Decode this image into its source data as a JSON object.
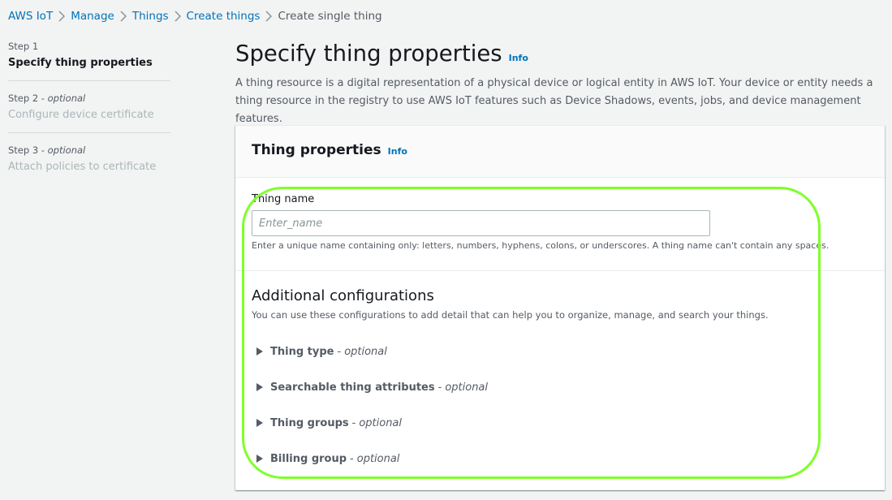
{
  "breadcrumb": {
    "items": [
      "AWS IoT",
      "Manage",
      "Things",
      "Create things"
    ],
    "current": "Create single thing"
  },
  "steps": [
    {
      "num": "Step 1",
      "optional": "",
      "title": "Specify thing properties"
    },
    {
      "num": "Step 2",
      "optional": "optional",
      "title": "Configure device certificate"
    },
    {
      "num": "Step 3",
      "optional": "optional",
      "title": "Attach policies to certificate"
    }
  ],
  "page": {
    "title": "Specify thing properties",
    "info": "Info",
    "description": "A thing resource is a digital representation of a physical device or logical entity in AWS IoT. Your device or entity needs a thing resource in the registry to use AWS IoT features such as Device Shadows, events, jobs, and device management features."
  },
  "panel": {
    "title": "Thing properties",
    "info": "Info",
    "thing_name": {
      "label": "Thing name",
      "placeholder": "Enter_name",
      "value": "",
      "hint": "Enter a unique name containing only: letters, numbers, hyphens, colons, or underscores. A thing name can't contain any spaces."
    },
    "additional": {
      "title": "Additional configurations",
      "description": "You can use these configurations to add detail that can help you to organize, manage, and search your things.",
      "expanders": [
        {
          "label": "Thing type",
          "sep": "-",
          "optional": "optional"
        },
        {
          "label": "Searchable thing attributes",
          "sep": "-",
          "optional": "optional"
        },
        {
          "label": "Thing groups",
          "sep": "-",
          "optional": "optional"
        },
        {
          "label": "Billing group",
          "sep": "-",
          "optional": "optional"
        }
      ]
    }
  },
  "colors": {
    "link": "#0073bb",
    "highlight": "#7fff2a",
    "background": "#f2f3f3"
  }
}
